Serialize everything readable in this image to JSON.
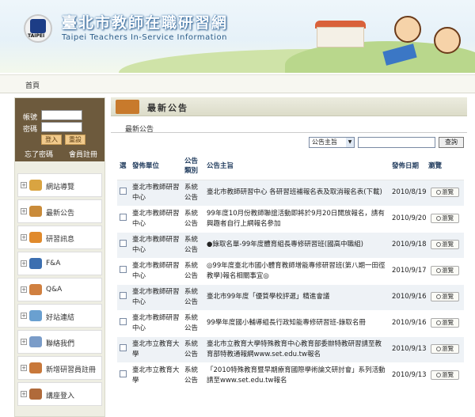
{
  "header": {
    "title_zh": "臺北市教師在職研習網",
    "title_en": "Taipei Teachers  In-Service Information",
    "logo_text": "TAIPEI"
  },
  "nav": {
    "home": "首頁"
  },
  "login": {
    "account_label": "帳號",
    "password_label": "密碼",
    "login_button": "登入",
    "reset_button": "重設",
    "forgot_password": "忘了密碼",
    "register": "會員註冊"
  },
  "sidebar": {
    "items": [
      {
        "label": "網站導覽",
        "icon": "map-icon",
        "color": "#d9a441"
      },
      {
        "label": "最新公告",
        "icon": "announcement-icon",
        "color": "#c98b3a"
      },
      {
        "label": "研習訊息",
        "icon": "books-icon",
        "color": "#e08a2c"
      },
      {
        "label": "F&A",
        "icon": "faq-icon",
        "color": "#3c6fb0"
      },
      {
        "label": "Q&A",
        "icon": "qa-icon",
        "color": "#d08040"
      },
      {
        "label": "好站連結",
        "icon": "link-icon",
        "color": "#6aa0d0"
      },
      {
        "label": "聯絡我們",
        "icon": "mail-icon",
        "color": "#7a9cc8"
      },
      {
        "label": "新增研習員註冊",
        "icon": "register-icon",
        "color": "#c8783a"
      },
      {
        "label": "講座登入",
        "icon": "lecturer-icon",
        "color": "#b06a3a"
      }
    ]
  },
  "main": {
    "section_title": "最新公告",
    "breadcrumb": "最新公告",
    "search": {
      "select_value": "公告主旨",
      "input_value": "",
      "button": "查詢"
    },
    "table": {
      "headers": [
        "選",
        "發佈單位",
        "公告類別",
        "公告主旨",
        "發佈日期",
        "瀏覽"
      ],
      "view_label": "瀏覽",
      "rows": [
        {
          "unit": "臺北市教師研習中心",
          "category": "系統公告",
          "subject": "臺北市教師研習中心 各研習班補報名表及取消報名表(下載)",
          "date": "2010/8/19"
        },
        {
          "unit": "臺北市教師研習中心",
          "category": "系統公告",
          "subject": "99年度10月份教師聯誼活動即將於9月20日開放報名，請有興趣者自行上網報名參加",
          "date": "2010/9/20"
        },
        {
          "unit": "臺北市教師研習中心",
          "category": "系統公告",
          "subject": "●錄取名單-99年度體育組長專修研習班(國高中職組)",
          "date": "2010/9/18"
        },
        {
          "unit": "臺北市教師研習中心",
          "category": "系統公告",
          "subject": "◎99年度臺北市國小體育教師增能專修研習班(第八期一田徑教學)報名相關事宜◎",
          "date": "2010/9/17"
        },
        {
          "unit": "臺北市教師研習中心",
          "category": "系統公告",
          "subject": "臺北市99年度「優質學校評選」精進會議",
          "date": "2010/9/16"
        },
        {
          "unit": "臺北市教師研習中心",
          "category": "系統公告",
          "subject": "99學年度國小輔導組長行政知能專修研習班-錄取名冊",
          "date": "2010/9/16"
        },
        {
          "unit": "臺北市立教育大學",
          "category": "系統公告",
          "subject": "臺北市立教育大學特殊教育中心教育部委辦特教研習請至教育部特教通報網www.set.edu.tw報名",
          "date": "2010/9/13"
        },
        {
          "unit": "臺北市立教育大學",
          "category": "系統公告",
          "subject": "「2010特殊教育暨早期療育國際學術論文研討會」系列活動請至www.set.edu.tw報名",
          "date": "2010/9/13"
        }
      ]
    }
  }
}
